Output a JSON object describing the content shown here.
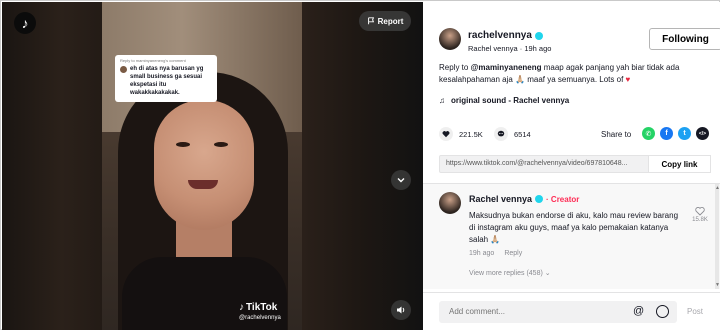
{
  "video": {
    "report_label": "Report",
    "comment_reply_header": "Reply to maminyaneneng's comment",
    "comment_reply_text": "eh di atas nya barusan yg small business ga sesuai ekspetasi itu wakakkakakakak.",
    "watermark_brand": "TikTok",
    "watermark_user": "@rachelvennya"
  },
  "author": {
    "username": "rachelvennya",
    "nickname": "Rachel vennya",
    "time_ago": "19h ago",
    "follow_label": "Following"
  },
  "description": {
    "prefix": "Reply to ",
    "mention": "@maminyaneneng",
    "text": " maap agak panjang yah biar tidak ada kesalahpahaman aja 🙏🏼 maaf ya semuanya. Lots of ",
    "heart": "♥"
  },
  "music": {
    "label": "original sound - Rachel vennya"
  },
  "stats": {
    "likes": "221.5K",
    "comments": "6514",
    "share_label": "Share to"
  },
  "share_targets": [
    {
      "name": "whatsapp",
      "color": "#25d366",
      "glyph": "✆"
    },
    {
      "name": "facebook",
      "color": "#1877f2",
      "glyph": "f"
    },
    {
      "name": "twitter",
      "color": "#1da1f2",
      "glyph": "t"
    },
    {
      "name": "embed",
      "color": "#161823",
      "glyph": "</>"
    }
  ],
  "link": {
    "url": "https://www.tiktok.com/@rachelvennya/video/697810648...",
    "copy_label": "Copy link"
  },
  "comment": {
    "author": "Rachel vennya",
    "creator_badge": "· Creator",
    "text": "Maksudnya bukan endorse di aku, kalo mau review barang di instagram aku guys, maaf ya kalo pemakaian katanya salah 🙏🏼",
    "time": "19h ago",
    "reply_label": "Reply",
    "like_count": "15.8K",
    "more_replies": "View more replies (458)"
  },
  "input": {
    "placeholder": "Add comment...",
    "at_symbol": "@",
    "post_label": "Post"
  },
  "colors": {
    "accent": "#fe2c55",
    "verified": "#20d5ec"
  }
}
